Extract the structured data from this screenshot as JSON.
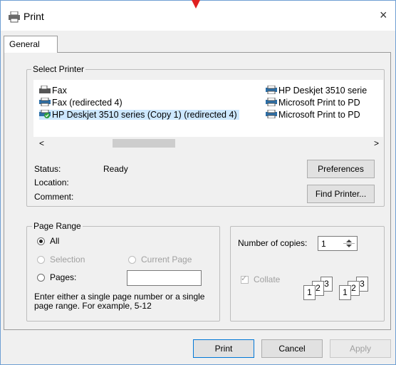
{
  "window": {
    "title": "Print",
    "close_symbol": "×",
    "accent_color": "#0078d7",
    "selection_color": "#cde8ff"
  },
  "tabs": [
    {
      "label": "General"
    }
  ],
  "select_printer": {
    "legend": "Select Printer",
    "printers": [
      {
        "name": "Fax",
        "icon": "fax-icon"
      },
      {
        "name": "Fax (redirected 4)",
        "icon": "printer-icon"
      },
      {
        "name": "HP Deskjet 3510 series (Copy 1) (redirected 4)",
        "icon": "default-printer-icon",
        "selected": true
      },
      {
        "name": "HP Deskjet 3510 serie",
        "icon": "printer-icon"
      },
      {
        "name": "Microsoft Print to PD",
        "icon": "printer-icon"
      },
      {
        "name": "Microsoft Print to PD",
        "icon": "printer-icon"
      }
    ],
    "scroll_left": "<",
    "scroll_right": ">",
    "status_label": "Status:",
    "status_value": "Ready",
    "location_label": "Location:",
    "comment_label": "Comment:",
    "preferences_button": "Preferences",
    "find_printer_button": "Find Printer..."
  },
  "page_range": {
    "legend": "Page Range",
    "all_label": "All",
    "selection_label": "Selection",
    "current_page_label": "Current Page",
    "pages_label": "Pages:",
    "pages_value": "",
    "hint": "Enter either a single page number or a single page range.  For example, 5-12",
    "selected_option": "All"
  },
  "copies": {
    "number_label": "Number of copies:",
    "number_value": "1",
    "collate_label": "Collate",
    "collate_checked": true,
    "collate_sets": [
      [
        "1",
        "2",
        "3"
      ],
      [
        "1",
        "2",
        "3"
      ]
    ]
  },
  "buttons": {
    "print": "Print",
    "cancel": "Cancel",
    "apply": "Apply"
  }
}
